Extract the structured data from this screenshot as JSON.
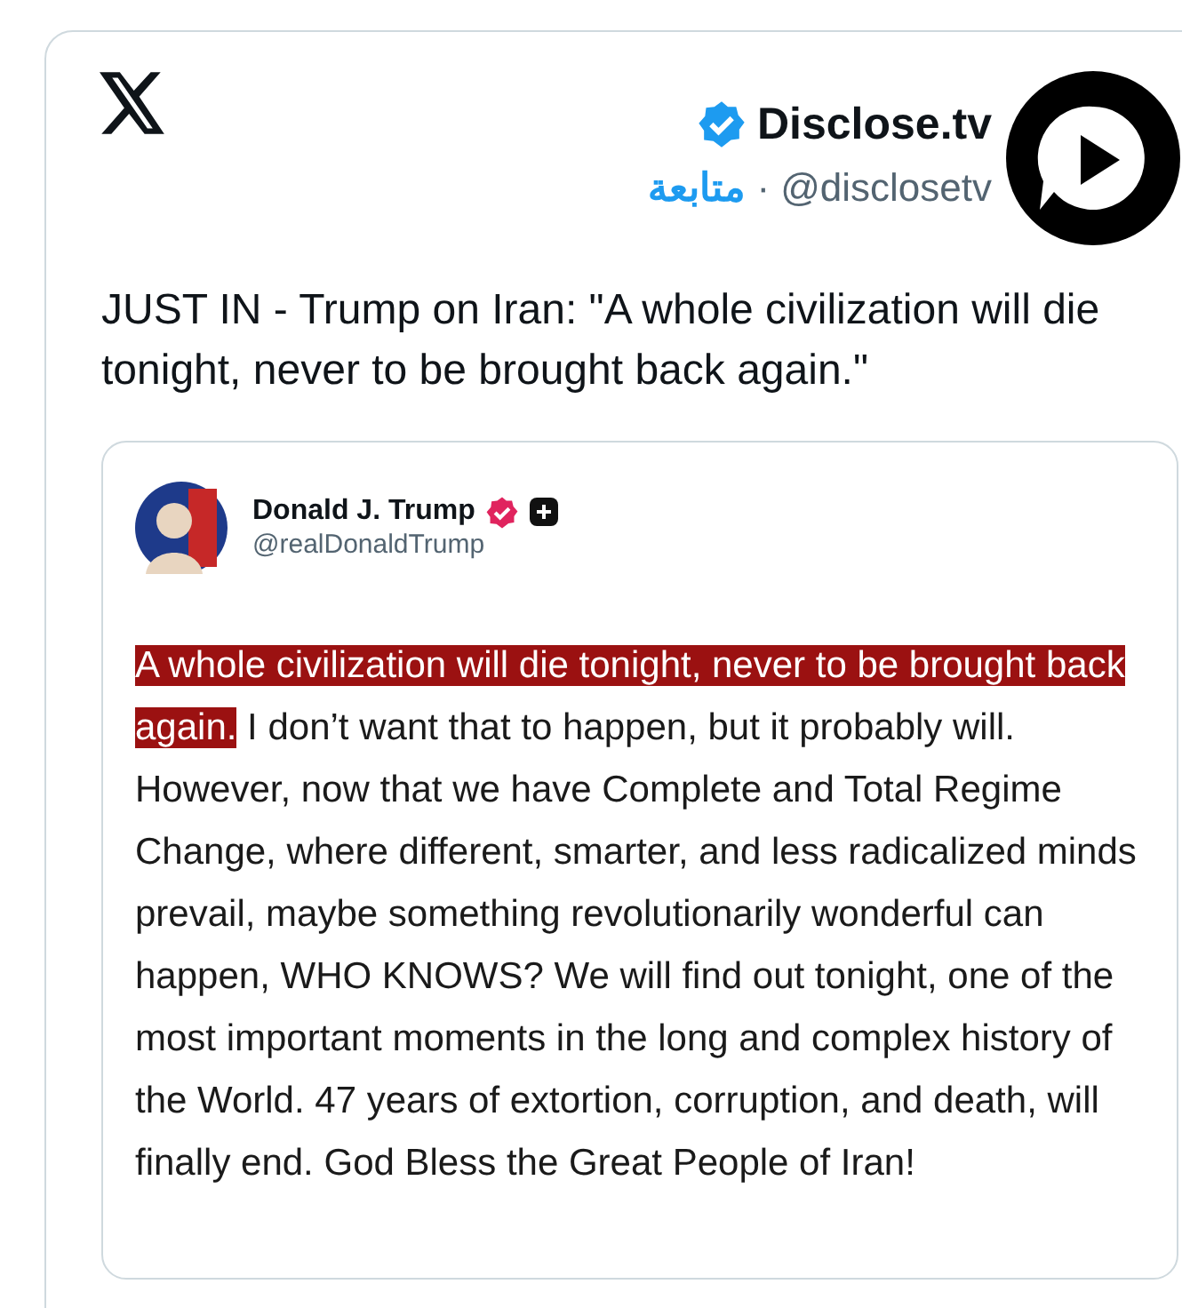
{
  "header": {
    "name": "Disclose.tv",
    "verified": true,
    "handle": "@disclosetv",
    "separator": "·",
    "follow": "متابعة"
  },
  "text": "JUST IN - Trump on Iran: \"A whole civilization will die tonight, never to be brought back again.\"",
  "quote": {
    "name": "Donald J. Trump",
    "verified": true,
    "handle": "@realDonaldTrump",
    "highlight": "A whole civilization will die tonight, never to be brought back again.",
    "body": " I don’t want that to happen, but it probably will. However, now that we have Complete and Total Regime Change, where different, smarter, and less radicalized minds prevail, maybe something revolutionarily wonderful can happen, WHO KNOWS? We will find out tonight, one of the most important moments in the long and complex history of the World. 47 years of extortion, corruption, and death, will finally end. God Bless the Great People of Iran!"
  }
}
